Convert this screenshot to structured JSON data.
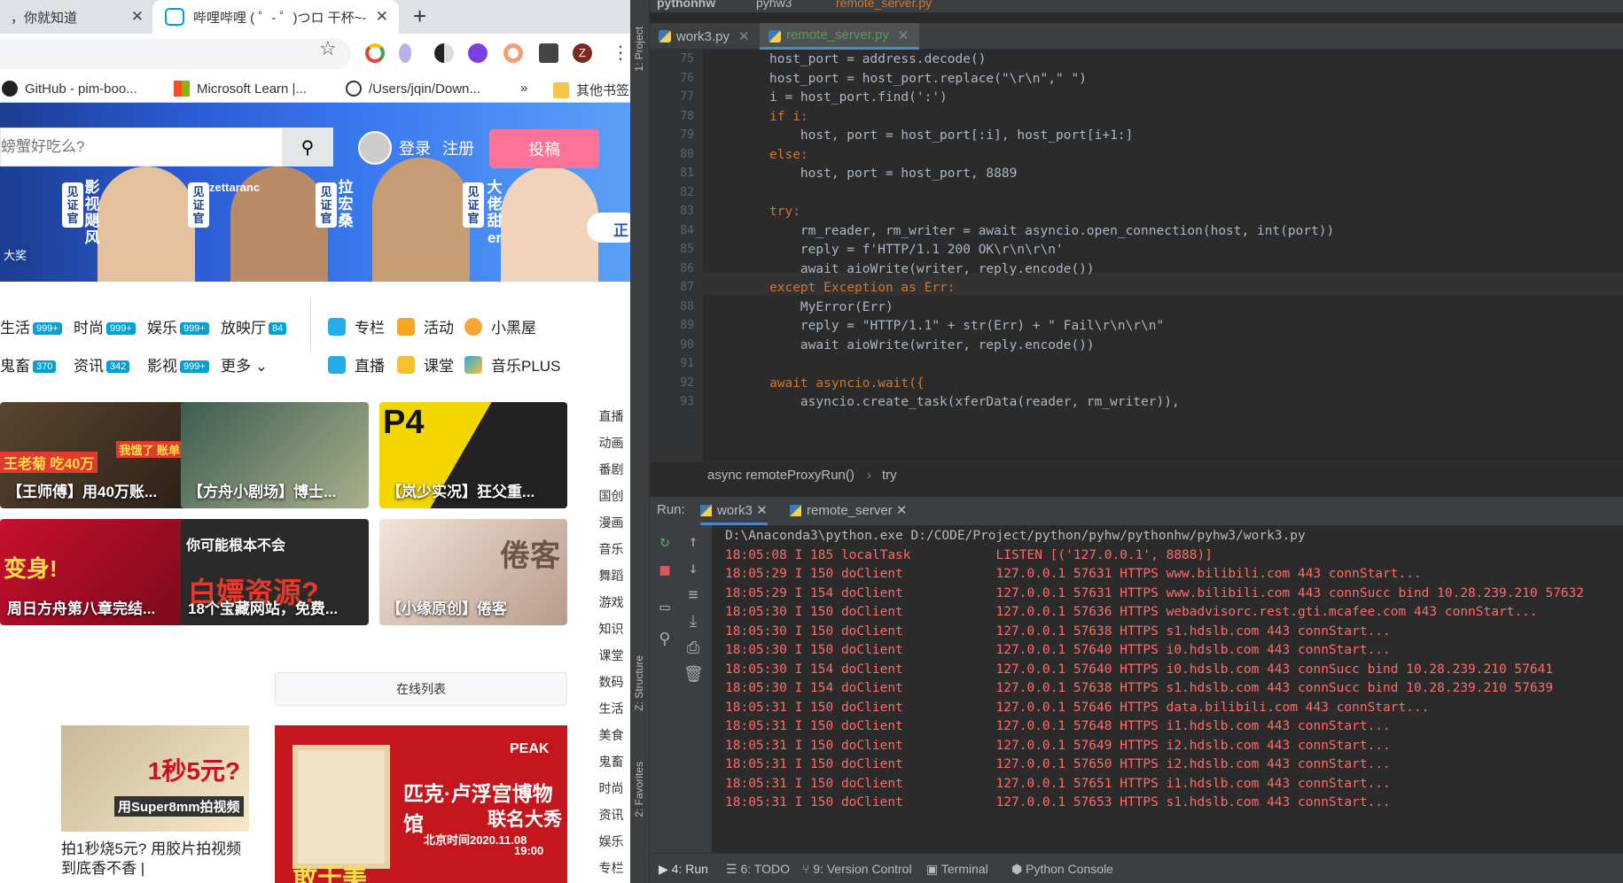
{
  "browser": {
    "tabs": [
      {
        "title": "，你就知道"
      },
      {
        "title": "哔哩哔哩 ( ゜- ゜)つロ 干杯~-"
      }
    ],
    "bookmarks": [
      "GitHub - pim-boo...",
      "Microsoft Learn |...",
      "/Users/jqin/Down...",
      "»",
      "其他书签"
    ],
    "profile_initial": "Z"
  },
  "bilibili": {
    "search_placeholder": "螃蟹好吃么?",
    "login": "登录",
    "register": "注册",
    "upload": "投稿",
    "banner": {
      "tags": [
        "见证官",
        "见证官",
        "见证官",
        "见证官"
      ],
      "names": [
        "影视飓风",
        "zettaranc",
        "拉宏桑",
        "大佬甜er"
      ],
      "left_text": "大奖",
      "right_text": "正"
    },
    "nav_rows": [
      [
        {
          "label": "生活",
          "count": "999+"
        },
        {
          "label": "时尚",
          "count": "999+"
        },
        {
          "label": "娱乐",
          "count": "999+"
        },
        {
          "label": "放映厅",
          "count": "84"
        }
      ],
      [
        {
          "label": "鬼畜",
          "count": "370"
        },
        {
          "label": "资讯",
          "count": "342"
        },
        {
          "label": "影视",
          "count": "999+"
        },
        {
          "label": "更多",
          "count": ""
        }
      ]
    ],
    "channels": [
      "专栏",
      "活动",
      "小黑屋",
      "直播",
      "课堂",
      "音乐PLUS"
    ],
    "cards": [
      "【王师傅】用40万账...",
      "【方舟小剧场】博士...",
      "【岚少实况】狂父重...",
      "周日方舟第八章完结...",
      "18个宝藏网站，免费...",
      "【小缘原创】倦客"
    ],
    "card_overlays": [
      "王老菊 吃40万",
      "我饿了 账单",
      "P4",
      "变身!",
      "你可能根本不会",
      "白嫖资源?",
      "倦客"
    ],
    "right_nav": [
      "直播",
      "动画",
      "番剧",
      "国创",
      "漫画",
      "音乐",
      "舞蹈",
      "游戏",
      "知识",
      "课堂",
      "数码",
      "生活",
      "美食",
      "鬼畜",
      "时尚",
      "资讯",
      "娱乐",
      "专栏"
    ],
    "online_list": "在线列表",
    "ad1": {
      "big": "1秒5元?",
      "small": "用Super8mm拍视频",
      "caption": "拍1秒烧5元? 用胶片拍视频到底香不香 |"
    },
    "ad2": {
      "title": "匹克·卢浮宫博物馆",
      "subtitle": "联名大秀",
      "date": "北京时间2020.11.08",
      "time": "19:00",
      "brand": "PEAK",
      "bottom": "敢于美"
    }
  },
  "ide": {
    "crumbs": [
      "pythonhw",
      "pyhw3",
      "remote_server.py"
    ],
    "side_labels": [
      "1: Project",
      "Z: Structure",
      "2: Favorites"
    ],
    "editor_tabs": [
      "work3.py",
      "remote_server.py"
    ],
    "code": [
      {
        "n": "75",
        "t": "host_port = address.decode()"
      },
      {
        "n": "76",
        "t": "host_port = host_port.replace(\"\\r\\n\",\" \")"
      },
      {
        "n": "77",
        "t": "i = host_port.find(':')"
      },
      {
        "n": "78",
        "t": "if i:"
      },
      {
        "n": "79",
        "t": "    host, port = host_port[:i], host_port[i+1:]"
      },
      {
        "n": "80",
        "t": "else:"
      },
      {
        "n": "81",
        "t": "    host, port = host_port, 8889"
      },
      {
        "n": "82",
        "t": ""
      },
      {
        "n": "83",
        "t": "try:"
      },
      {
        "n": "84",
        "t": "    rm_reader, rm_writer = await asyncio.open_connection(host, int(port))"
      },
      {
        "n": "85",
        "t": "    reply = f'HTTP/1.1 200 OK\\r\\n\\r\\n'"
      },
      {
        "n": "86",
        "t": "    await aioWrite(writer, reply.encode())"
      },
      {
        "n": "87",
        "t": "except Exception as Err:"
      },
      {
        "n": "88",
        "t": "    MyError(Err)"
      },
      {
        "n": "89",
        "t": "    reply = \"HTTP/1.1\" + str(Err) + \" Fail\\r\\n\\r\\n\""
      },
      {
        "n": "90",
        "t": "    await aioWrite(writer, reply.encode())"
      },
      {
        "n": "91",
        "t": ""
      },
      {
        "n": "92",
        "t": "await asyncio.wait({"
      },
      {
        "n": "93",
        "t": "    asyncio.create_task(xferData(reader, rm_writer)),"
      }
    ],
    "code_crumb": [
      "async remoteProxyRun()",
      "try"
    ],
    "run_label": "Run:",
    "run_tabs": [
      "work3",
      "remote_server"
    ],
    "console": [
      "D:\\Anaconda3\\python.exe D:/CODE/Project/python/pyhw/pythonhw/pyhw3/work3.py",
      "18:05:08 I 185 localTask           LISTEN [('127.0.0.1', 8888)]",
      "18:05:29 I 150 doClient            127.0.0.1 57631 HTTPS www.bilibili.com 443 connStart...",
      "18:05:29 I 154 doClient            127.0.0.1 57631 HTTPS www.bilibili.com 443 connSucc bind 10.28.239.210 57632",
      "18:05:30 I 150 doClient            127.0.0.1 57636 HTTPS webadvisorc.rest.gti.mcafee.com 443 connStart...",
      "18:05:30 I 150 doClient            127.0.0.1 57638 HTTPS s1.hdslb.com 443 connStart...",
      "18:05:30 I 150 doClient            127.0.0.1 57640 HTTPS i0.hdslb.com 443 connStart...",
      "18:05:30 I 154 doClient            127.0.0.1 57640 HTTPS i0.hdslb.com 443 connSucc bind 10.28.239.210 57641",
      "18:05:30 I 154 doClient            127.0.0.1 57638 HTTPS s1.hdslb.com 443 connSucc bind 10.28.239.210 57639",
      "18:05:31 I 150 doClient            127.0.0.1 57646 HTTPS data.bilibili.com 443 connStart...",
      "18:05:31 I 150 doClient            127.0.0.1 57648 HTTPS i1.hdslb.com 443 connStart...",
      "18:05:31 I 150 doClient            127.0.0.1 57649 HTTPS i2.hdslb.com 443 connStart...",
      "18:05:31 I 150 doClient            127.0.0.1 57650 HTTPS i2.hdslb.com 443 connStart...",
      "18:05:31 I 150 doClient            127.0.0.1 57651 HTTPS i1.hdslb.com 443 connStart...",
      "18:05:31 I 150 doClient            127.0.0.1 57653 HTTPS s1.hdslb.com 443 connStart..."
    ],
    "bottom_tabs": [
      "4: Run",
      "6: TODO",
      "9: Version Control",
      "Terminal",
      "Python Console"
    ]
  }
}
